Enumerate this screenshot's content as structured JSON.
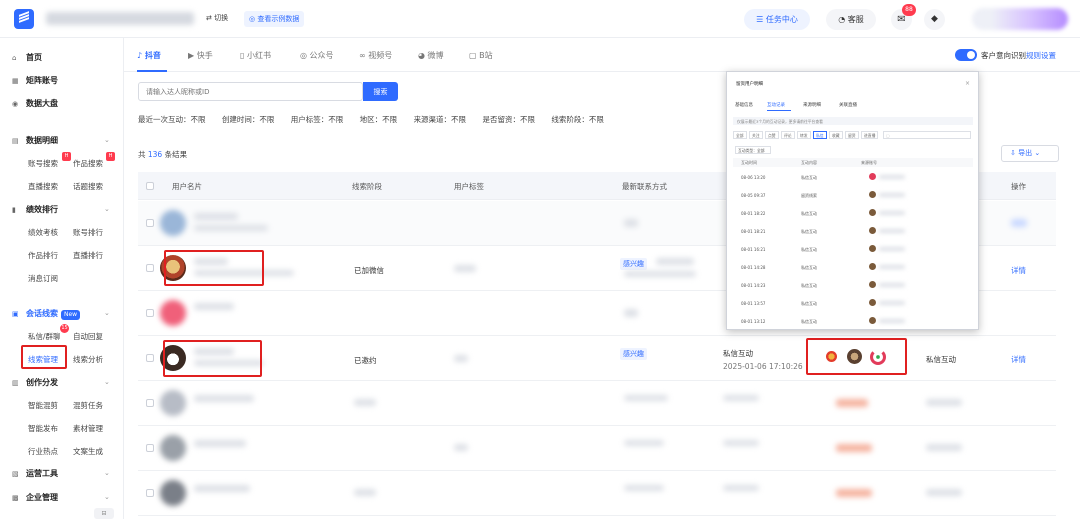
{
  "header": {
    "switch_label": "切换",
    "demo_label": "查看示例数据",
    "task_center": "任务中心",
    "customer_service": "客服",
    "msg_badge": "88"
  },
  "sidebar": {
    "home": "首页",
    "matrix": "矩阵账号",
    "dashboard": "数据大盘",
    "data_detail": "数据明细",
    "account_search": "账号搜索",
    "works_search": "作品搜索",
    "live_search": "直播搜索",
    "topic_search": "话题搜索",
    "performance_rank": "绩效排行",
    "perf_review": "绩效考核",
    "account_rank": "账号排行",
    "works_rank": "作品排行",
    "live_rank": "直播排行",
    "msg_subscribe": "消息订阅",
    "session_leads": "会话线索",
    "new_label": "New",
    "private_msg": "私信/群聊",
    "private_badge": "15",
    "auto_reply": "自动回复",
    "lead_mgmt": "线索管理",
    "lead_analysis": "线索分析",
    "creation": "创作分发",
    "smart_mix": "智能混剪",
    "mix_task": "混剪任务",
    "smart_publish": "智能发布",
    "material": "素材管理",
    "industry_hot": "行业热点",
    "copy_gen": "文案生成",
    "ops_tools": "运营工具",
    "enterprise": "企业管理",
    "badge_h": "H"
  },
  "tabs": [
    "抖音",
    "快手",
    "小红书",
    "公众号",
    "视频号",
    "微博",
    "B站"
  ],
  "intent": {
    "text": "客户意向识别",
    "link": "规则设置"
  },
  "search": {
    "placeholder": "请输入达人昵称或ID",
    "button": "搜索"
  },
  "filters": [
    "最近一次互动：不限",
    "创建时间：不限",
    "用户标签：不限",
    "地区：不限",
    "来源渠道：不限",
    "是否留资：不限",
    "线索阶段：不限"
  ],
  "results": {
    "prefix": "共",
    "count": "136",
    "suffix": "条结果"
  },
  "export_label": "导出",
  "table": {
    "headers": [
      "用户名片",
      "线索阶段",
      "用户标签",
      "最新联系方式",
      "操作"
    ],
    "rows": [
      {
        "stage": "已加微信",
        "tag": "感兴趣",
        "detail": "详情"
      },
      {
        "stage": "已邀约",
        "tag": "感兴趣",
        "recent_type": "私信互动",
        "recent_time": "2025-01-06 17:10:26",
        "source": "私信互动",
        "detail": "详情"
      }
    ]
  },
  "popup": {
    "title": "留资用户明细",
    "tabs": [
      "基础信息",
      "互动记录",
      "来源明细",
      "关联直播"
    ],
    "notice": "仅展示最近3个月的互动记录，更多请前往平台查看",
    "chips": [
      "全部",
      "关注",
      "点赞",
      "评论",
      "转发",
      "私信",
      "收藏",
      "留资",
      "进直播"
    ],
    "select": "互动类型：全部",
    "headers": [
      "互动时间",
      "互动内容",
      "来源账号"
    ],
    "rows": [
      {
        "time": "08-06 13:20",
        "type": "私信互动"
      },
      {
        "time": "08-05 09:37",
        "type": "留资线索"
      },
      {
        "time": "08-01 18:22",
        "type": "私信互动"
      },
      {
        "time": "08-01 18:21",
        "type": "私信互动"
      },
      {
        "time": "08-01 16:21",
        "type": "私信互动"
      },
      {
        "time": "08-01 14:28",
        "type": "私信互动"
      },
      {
        "time": "08-01 14:23",
        "type": "私信互动"
      },
      {
        "time": "08-01 13:57",
        "type": "私信互动"
      },
      {
        "time": "08-01 13:12",
        "type": "私信互动"
      }
    ]
  }
}
